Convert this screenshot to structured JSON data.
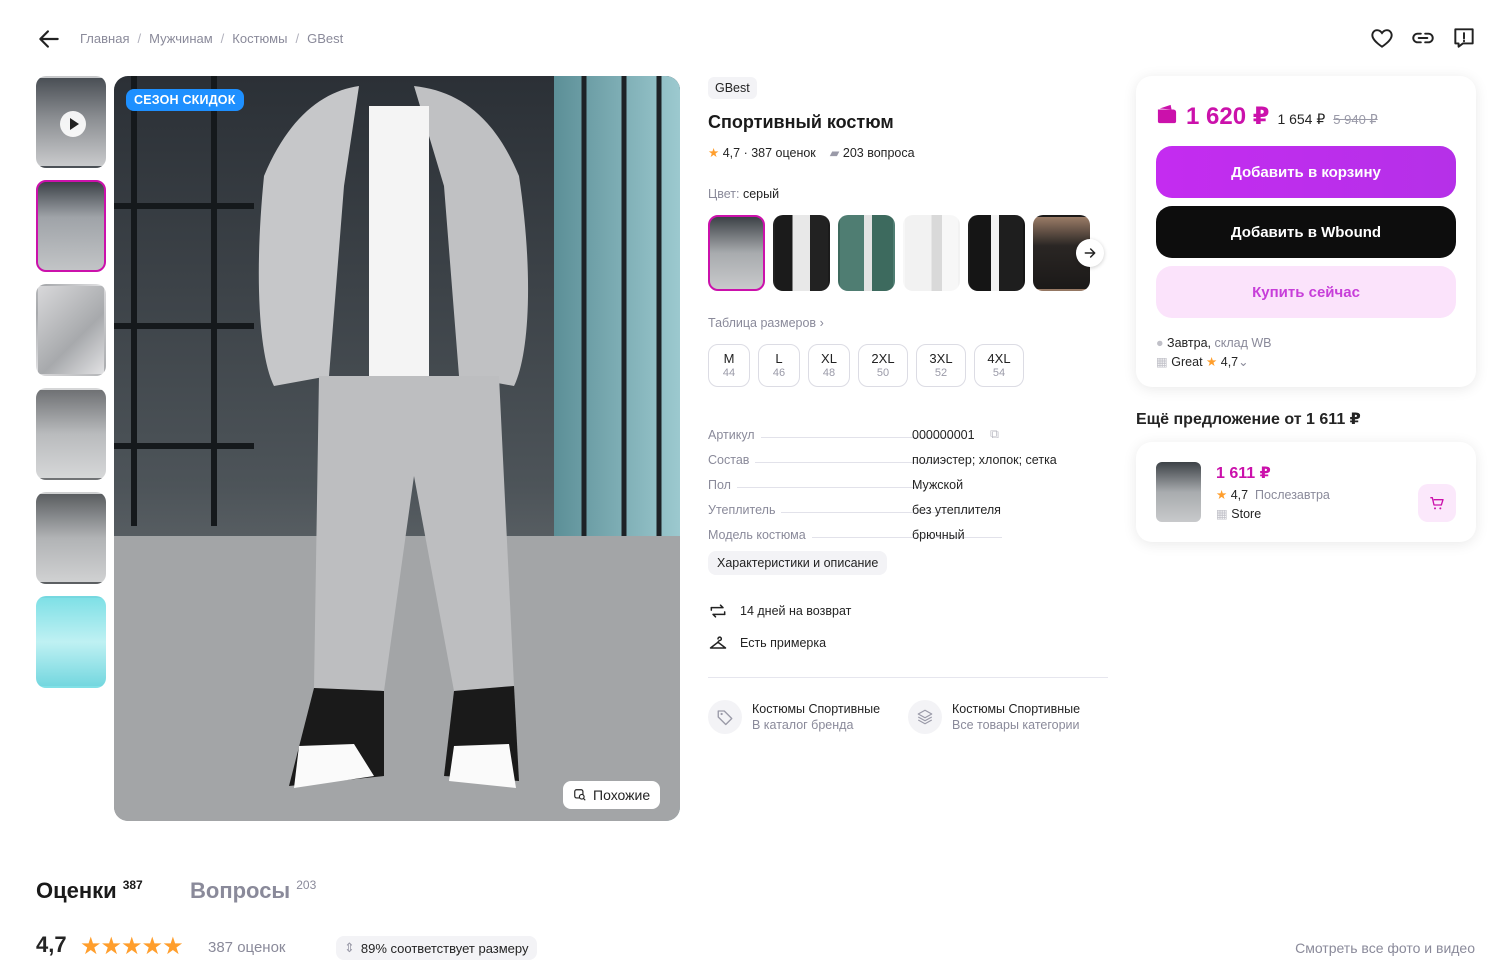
{
  "breadcrumbs": [
    "Главная",
    "Мужчинам",
    "Костюмы",
    "GBest"
  ],
  "gallery": {
    "badge": "СЕЗОН СКИДОК",
    "similar_label": "Похожие",
    "thumbnail_count": 6
  },
  "product": {
    "brand": "GBest",
    "title": "Спортивный костюм",
    "rating": "4,7",
    "reviews_text": "387 оценок",
    "questions_text": "203 вопроса",
    "color_label": "Цвет:",
    "color_value": "серый",
    "size_table_label": "Таблица размеров",
    "sizes": [
      {
        "label": "M",
        "ru": "44"
      },
      {
        "label": "L",
        "ru": "46"
      },
      {
        "label": "XL",
        "ru": "48"
      },
      {
        "label": "2XL",
        "ru": "50"
      },
      {
        "label": "3XL",
        "ru": "52"
      },
      {
        "label": "4XL",
        "ru": "54"
      }
    ],
    "specs": [
      {
        "key": "Артикул",
        "value": "000000001"
      },
      {
        "key": "Состав",
        "value": "полиэстер; хлопок; сетка"
      },
      {
        "key": "Пол",
        "value": "Мужской"
      },
      {
        "key": "Утеплитель",
        "value": "без утеплителя"
      },
      {
        "key": "Модель костюма",
        "value": "брючный"
      }
    ],
    "chars_button": "Характеристики и описание",
    "perks": [
      "14 дней на возврат",
      "Есть примерка"
    ],
    "category_links": [
      {
        "title": "Костюмы Спортивные",
        "sub": "В каталог бренда"
      },
      {
        "title": "Костюмы Спортивные",
        "sub": "Все товары категории"
      }
    ]
  },
  "buy": {
    "price": "1 620 ₽",
    "price_mid": "1 654 ₽",
    "price_old": "5 940 ₽",
    "add_to_cart": "Добавить в корзину",
    "add_to_wbound": "Добавить в Wbound",
    "buy_now": "Купить сейчас",
    "delivery_day": "Завтра,",
    "delivery_from": "склад WB",
    "seller": "Great",
    "seller_rating": "4,7"
  },
  "other_offer": {
    "title": "Ещё предложение от 1 611 ₽",
    "price": "1 611 ₽",
    "rating": "4,7",
    "delivery": "Послезавтра",
    "seller": "Store"
  },
  "bottom": {
    "tab_reviews": "Оценки",
    "tab_reviews_count": "387",
    "tab_questions": "Вопросы",
    "tab_questions_count": "203",
    "rating": "4,7",
    "stars": 5,
    "reviews_text": "387 оценок",
    "fit_text": "89% соответствует размеру",
    "all_media": "Смотреть все фото и видео"
  },
  "colors": {
    "accent": "#cb11ab",
    "star": "#ff9e2c",
    "badge": "#1e90ff"
  }
}
